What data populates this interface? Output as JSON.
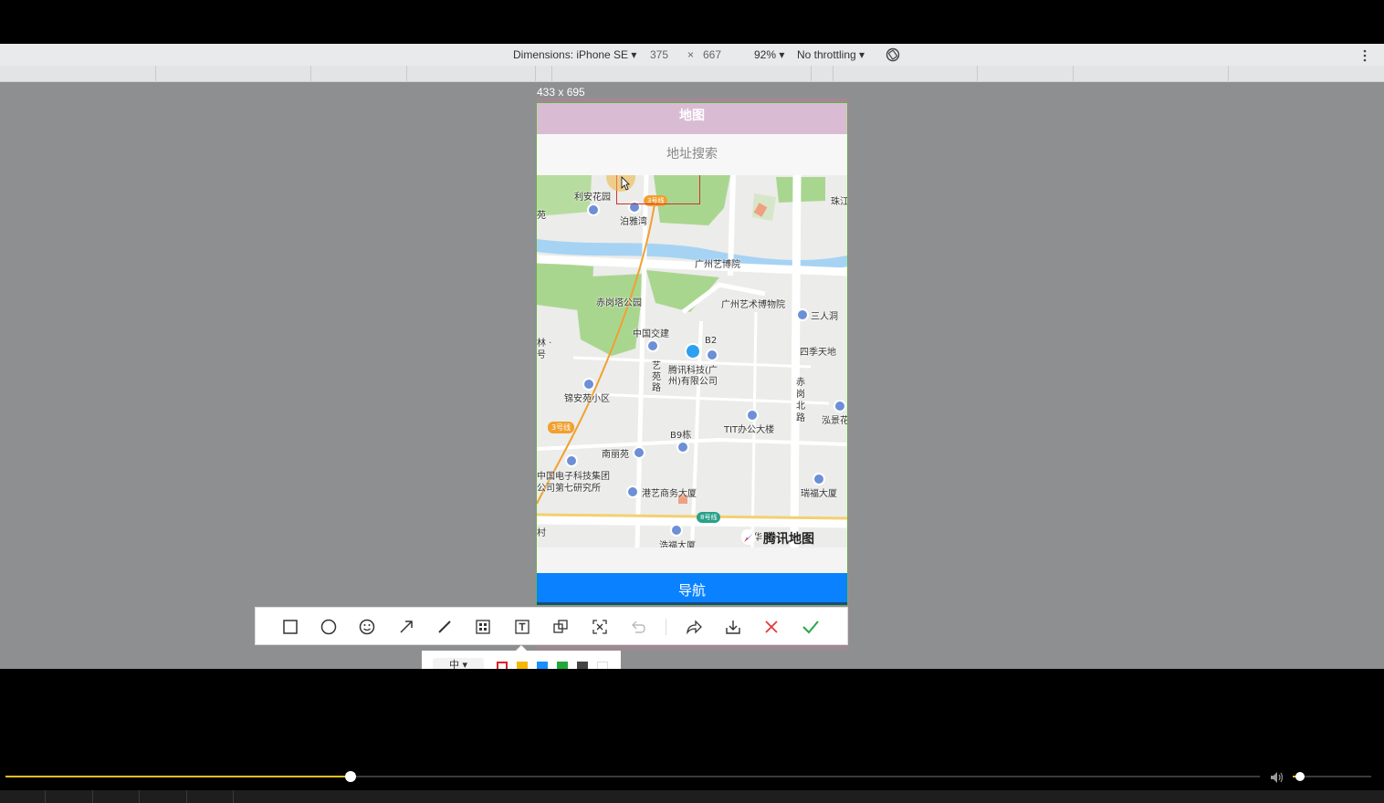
{
  "devtools": {
    "device": "Dimensions: iPhone SE ▾",
    "width": "375",
    "times": "×",
    "height": "667",
    "zoom": "92% ▾",
    "throttle": "No throttling ▾",
    "more_icon": "kebab-icon",
    "rotate_icon": "rotate-icon"
  },
  "selection_size": "433 x 695",
  "app": {
    "header_title": "地图",
    "search_placeholder": "地址搜索",
    "nav_button": "导航",
    "map_logo": "腾讯地图",
    "pois": [
      "利安花园",
      "泊雅湾",
      "珠江",
      "广州艺博院",
      "赤岗塔公园",
      "广州艺术博物院",
      "三人洞",
      "中国交建",
      "B2",
      "四季天地",
      "腾讯科技(广",
      "州)有限公司",
      "艺",
      "苑",
      "路",
      "林 ·",
      "号",
      "锦安苑小区",
      "赤",
      "岗",
      "北",
      "路",
      "泓景花",
      "B9栋",
      "TIT办公大楼",
      "南丽苑",
      "中国电子科技集团",
      "公司第七研究所",
      "港艺商务大厦",
      "瑞福大厦",
      "华",
      "浩福大厦",
      "村",
      "苑"
    ],
    "line_badges": [
      "3号线",
      "3号线",
      "8号线"
    ]
  },
  "snip_toolbar": {
    "tools": [
      "rectangle-icon",
      "ellipse-icon",
      "emoji-icon",
      "arrow-icon",
      "pencil-icon",
      "mosaic-icon",
      "text-icon",
      "copy-icon",
      "ocr-icon",
      "undo-icon",
      "share-icon",
      "download-icon",
      "cancel-icon",
      "confirm-icon"
    ],
    "size_label": "中 ▾",
    "swatches": [
      "#e02020",
      "#f5b800",
      "#1890ff",
      "#22a83a",
      "#444444",
      "#ffffff"
    ]
  },
  "player": {
    "progress": 0.275,
    "volume": 0.09,
    "volume_icon": "speaker-icon"
  }
}
